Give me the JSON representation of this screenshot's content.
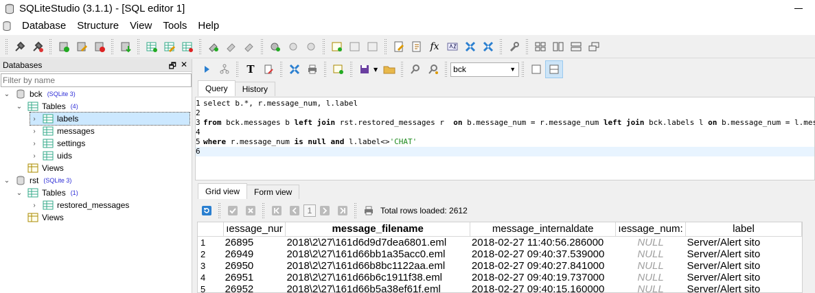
{
  "window": {
    "title": "SQLiteStudio (3.1.1) - [SQL editor 1]"
  },
  "menu": [
    "Database",
    "Structure",
    "View",
    "Tools",
    "Help"
  ],
  "databases_panel": {
    "title": "Databases",
    "filter_placeholder": "Filter by name",
    "tree": {
      "bck": {
        "name": "bck",
        "type": "(SQLite 3)",
        "tables_label": "Tables",
        "tables_count": "(4)",
        "tables": [
          "labels",
          "messages",
          "settings",
          "uids"
        ],
        "views_label": "Views"
      },
      "rst": {
        "name": "rst",
        "type": "(SQLite 3)",
        "tables_label": "Tables",
        "tables_count": "(1)",
        "tables": [
          "restored_messages"
        ],
        "views_label": "Views"
      }
    }
  },
  "editor": {
    "db_selected": "bck",
    "tabs": [
      "Query",
      "History"
    ],
    "lines": {
      "l1": "select b.*, r.message_num, l.label",
      "l3a": "from",
      "l3b": " bck.messages b ",
      "l3c": "left join",
      "l3d": " rst.restored_messages r  ",
      "l3e": "on",
      "l3f": " b.message_num = r.message_num ",
      "l3g": "left join",
      "l3h": " bck.labels l ",
      "l3i": "on",
      "l3j": " b.message_num = l.message_num",
      "l5a": "where",
      "l5b": " r.message_num ",
      "l5c": "is null and",
      "l5d": " l.label<>",
      "l5e": "'CHAT'"
    },
    "line_numbers": [
      "1",
      "2",
      "3",
      "4",
      "5",
      "6"
    ]
  },
  "results": {
    "tabs": [
      "Grid view",
      "Form view"
    ],
    "page": "1",
    "total_rows": "Total rows loaded: 2612",
    "columns": [
      "ıessage_nur",
      "message_filename",
      "message_internaldate",
      "ıessage_num:",
      "label"
    ],
    "rows": [
      [
        "1",
        "26895",
        "2018\\2\\27\\161d6d9d7dea6801.eml",
        "2018-02-27 11:40:56.286000",
        "NULL",
        "Server/Alert sito"
      ],
      [
        "2",
        "26949",
        "2018\\2\\27\\161d66bb1a35acc0.eml",
        "2018-02-27 09:40:37.539000",
        "NULL",
        "Server/Alert sito"
      ],
      [
        "3",
        "26950",
        "2018\\2\\27\\161d66b8bc1122aa.eml",
        "2018-02-27 09:40:27.841000",
        "NULL",
        "Server/Alert sito"
      ],
      [
        "4",
        "26951",
        "2018\\2\\27\\161d66b6c1911f38.eml",
        "2018-02-27 09:40:19.737000",
        "NULL",
        "Server/Alert sito"
      ],
      [
        "5",
        "26952",
        "2018\\2\\27\\161d66b5a38ef61f.eml",
        "2018-02-27 09:40:15.160000",
        "NULL",
        "Server/Alert sito"
      ]
    ]
  }
}
